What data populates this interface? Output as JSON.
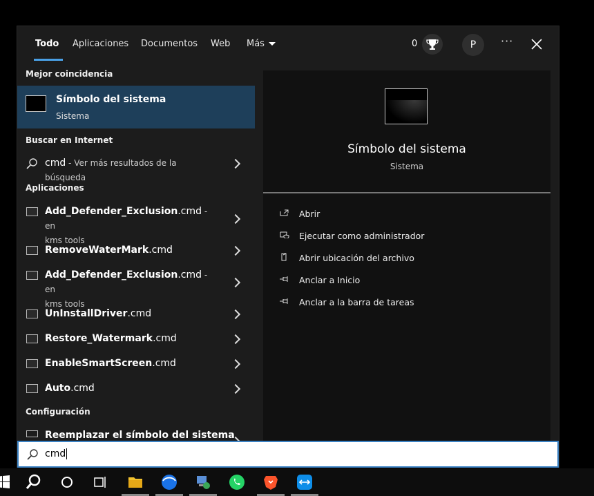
{
  "tabs": {
    "all": "Todo",
    "apps": "Aplicaciones",
    "documents": "Documentos",
    "web": "Web",
    "more": "Más"
  },
  "header": {
    "points": "0",
    "avatar_letter": "P",
    "more": "···"
  },
  "sections": {
    "best_match": "Mejor coincidencia",
    "web_search": "Buscar en Internet",
    "apps": "Aplicaciones",
    "settings": "Configuración"
  },
  "best_match": {
    "title": "Símbolo del sistema",
    "subtitle": "Sistema"
  },
  "web_search": {
    "query": "cmd",
    "hint": " - Ver más resultados de la búsqueda"
  },
  "apps": [
    {
      "name": "Add_Defender_Exclusion",
      "ext": ".cmd",
      "meta": " - en",
      "location": "kms tools"
    },
    {
      "name": "RemoveWaterMark",
      "ext": ".cmd",
      "meta": "",
      "location": ""
    },
    {
      "name": "Add_Defender_Exclusion",
      "ext": ".cmd",
      "meta": " - en",
      "location": "kms tools"
    },
    {
      "name": "UnInstallDriver",
      "ext": ".cmd",
      "meta": "",
      "location": ""
    },
    {
      "name": "Restore_Watermark",
      "ext": ".cmd",
      "meta": "",
      "location": ""
    },
    {
      "name": "EnableSmartScreen",
      "ext": ".cmd",
      "meta": "",
      "location": ""
    },
    {
      "name": "Auto",
      "ext": ".cmd",
      "meta": "",
      "location": ""
    }
  ],
  "settings": [
    {
      "label": "Reemplazar el símbolo del sistema"
    }
  ],
  "preview": {
    "title": "Símbolo del sistema",
    "subtitle": "Sistema",
    "actions": [
      "Abrir",
      "Ejecutar como administrador",
      "Abrir ubicación del archivo",
      "Anclar a Inicio",
      "Anclar a la barra de tareas"
    ]
  },
  "search": {
    "value": "cmd"
  },
  "taskbar": [
    "windows-icon",
    "search-icon",
    "cortana-icon",
    "task-view-icon",
    "file-explorer-icon",
    "chrome-icon",
    "network-icon",
    "whatsapp-icon",
    "brave-icon",
    "teamviewer-icon"
  ]
}
